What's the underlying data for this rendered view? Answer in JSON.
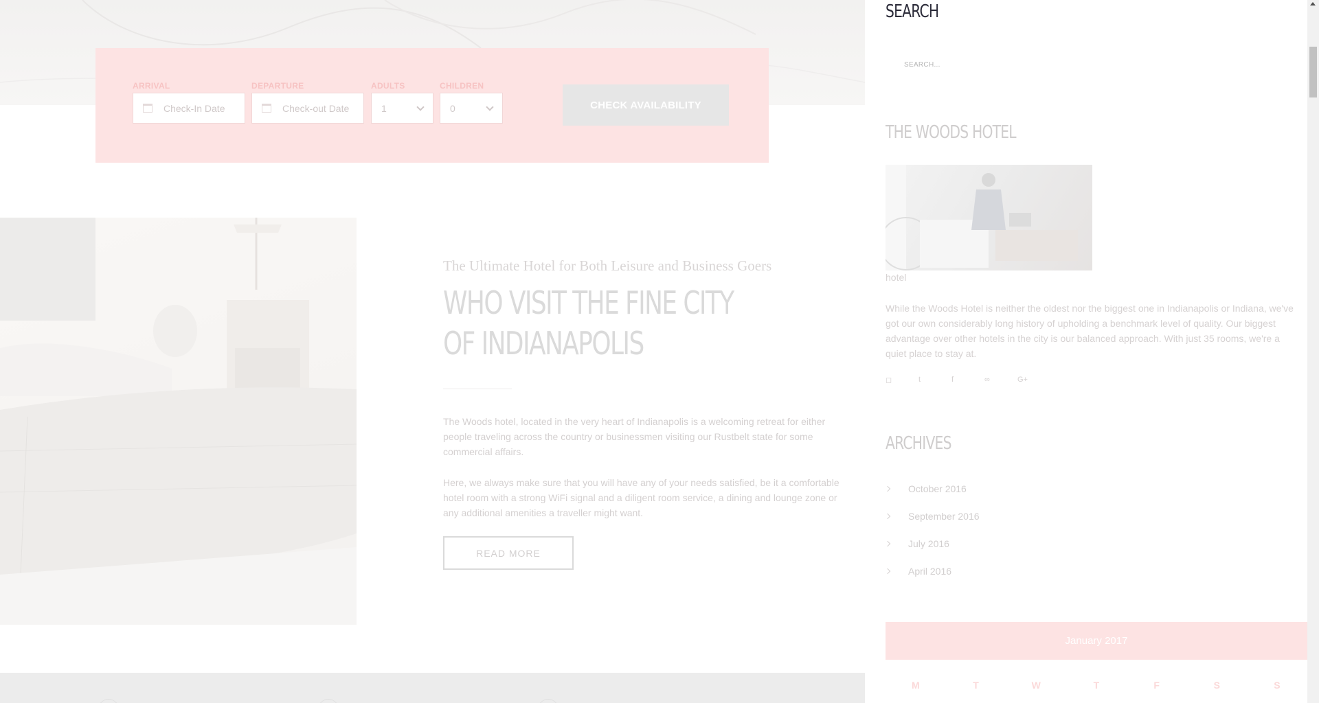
{
  "booking": {
    "arrival_label": "ARRIVAL",
    "arrival_placeholder": "Check-In Date",
    "departure_label": "DEPARTURE",
    "departure_placeholder": "Check-out Date",
    "adults_label": "ADULTS",
    "adults_value": "1",
    "children_label": "CHILDREN",
    "children_value": "0",
    "check_button": "CHECK AVAILABILITY"
  },
  "intro": {
    "subtitle": "The Ultimate Hotel for Both Leisure and Business Goers",
    "title": "WHO VISIT THE FINE CITY OF INDIANAPOLIS",
    "paragraph1": "The Woods hotel, located in the very heart of Indianapolis is a welcoming retreat for either people traveling across the country or businessmen visiting our Rustbelt state for some commercial affairs.",
    "paragraph2": "Here, we always make sure that you will have any of your needs satisfied, be it a comfortable hotel room with a strong WiFi signal and a diligent room service, a dining and lounge zone or any additional amenities a traveller might want.",
    "read_more": "READ MORE"
  },
  "sidebar": {
    "search_title": "SEARCH",
    "search_placeholder": "SEARCH...",
    "about_title": "THE WOODS HOTEL",
    "about_caption": "hotel",
    "about_text": "While the Woods Hotel is neither the oldest nor the biggest one in Indianapolis or Indiana, we've got our own considerably long history of upholding a benchmark level of quality. Our biggest advantage over other hotels in the city is our balanced approach. With just 35 rooms, we're a quiet place to stay at.",
    "socials": [
      {
        "icon": "instagram-icon",
        "glyph": "◻"
      },
      {
        "icon": "twitter-icon",
        "glyph": "t"
      },
      {
        "icon": "facebook-icon",
        "glyph": "f"
      },
      {
        "icon": "tripadvisor-icon",
        "glyph": "∞"
      },
      {
        "icon": "google-plus-icon",
        "glyph": "G+"
      }
    ],
    "archives_title": "ARCHIVES",
    "archives": [
      "October 2016",
      "September 2016",
      "July 2016",
      "April 2016"
    ],
    "calendar": {
      "month": "January 2017",
      "days": [
        "M",
        "T",
        "W",
        "T",
        "F",
        "S",
        "S"
      ]
    }
  },
  "colors": {
    "accent_pink": "#fde3e3",
    "heading_dark": "#2c2c3a"
  }
}
